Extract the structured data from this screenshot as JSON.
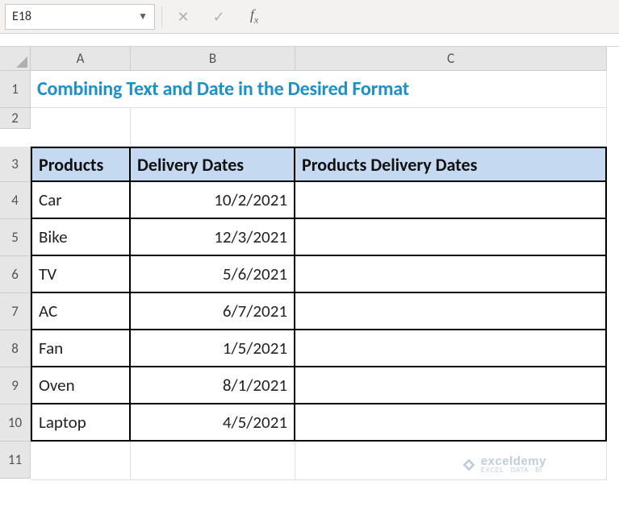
{
  "nameBox": {
    "value": "E18"
  },
  "formulaBar": {
    "value": ""
  },
  "columns": [
    "A",
    "B",
    "C"
  ],
  "rows": [
    "1",
    "2",
    "3",
    "4",
    "5",
    "6",
    "7",
    "8",
    "9",
    "10",
    "11"
  ],
  "title": "Combining Text and Date in the Desired Format",
  "table": {
    "headers": [
      "Products",
      "Delivery Dates",
      "Products Delivery Dates"
    ],
    "data": [
      {
        "product": "Car",
        "date": "10/2/2021",
        "combined": ""
      },
      {
        "product": "Bike",
        "date": "12/3/2021",
        "combined": ""
      },
      {
        "product": "TV",
        "date": "5/6/2021",
        "combined": ""
      },
      {
        "product": "AC",
        "date": "6/7/2021",
        "combined": ""
      },
      {
        "product": "Fan",
        "date": "1/5/2021",
        "combined": ""
      },
      {
        "product": "Oven",
        "date": "8/1/2021",
        "combined": ""
      },
      {
        "product": "Laptop",
        "date": "4/5/2021",
        "combined": ""
      }
    ]
  },
  "watermark": {
    "main": "exceldemy",
    "sub": "EXCEL · DATA · BI"
  }
}
